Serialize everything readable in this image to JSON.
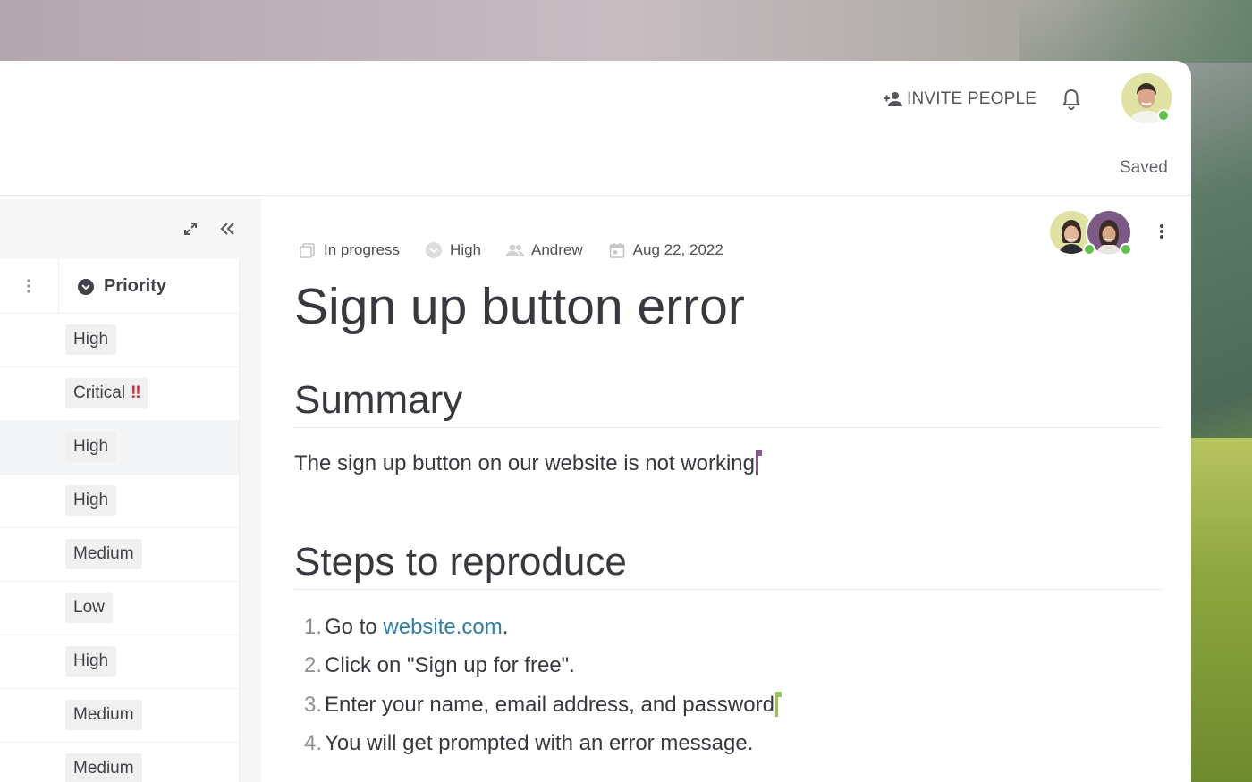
{
  "header": {
    "invite_label": "INVITE PEOPLE",
    "saved_label": "Saved"
  },
  "sidebar": {
    "column_title": "Priority",
    "rows": [
      {
        "label": "High"
      },
      {
        "label": "Critical",
        "flag": "‼"
      },
      {
        "label": "High"
      },
      {
        "label": "High"
      },
      {
        "label": "Medium"
      },
      {
        "label": "Low"
      },
      {
        "label": "High"
      },
      {
        "label": "Medium"
      },
      {
        "label": "Medium"
      }
    ]
  },
  "doc": {
    "meta": {
      "status": "In progress",
      "priority": "High",
      "assignee": "Andrew",
      "date": "Aug 22, 2022"
    },
    "title": "Sign up button error",
    "summary_heading": "Summary",
    "summary_text": "The sign up button on our website is not working",
    "steps_heading": "Steps to reproduce",
    "steps": [
      {
        "num": "1.",
        "before": "Go to ",
        "link": "website.com",
        "after": "."
      },
      {
        "num": "2.",
        "text": "Click on \"Sign up for free\"."
      },
      {
        "num": "3.",
        "text": "Enter your name, email address, and password"
      },
      {
        "num": "4.",
        "text": "You will get prompted with an error message."
      }
    ]
  },
  "colors": {
    "accent_link": "#2f7ea8",
    "cursor_purple": "#8a5a8f",
    "cursor_green": "#95c25a",
    "critical_red": "#d62b3c",
    "online": "#5fc24a"
  },
  "icons": [
    "add-person-icon",
    "bell-icon",
    "expand-icon",
    "collapse-left-icon",
    "kebab-icon",
    "priority-circle-icon",
    "status-icon",
    "priority-icon",
    "assignee-icon",
    "calendar-icon"
  ]
}
